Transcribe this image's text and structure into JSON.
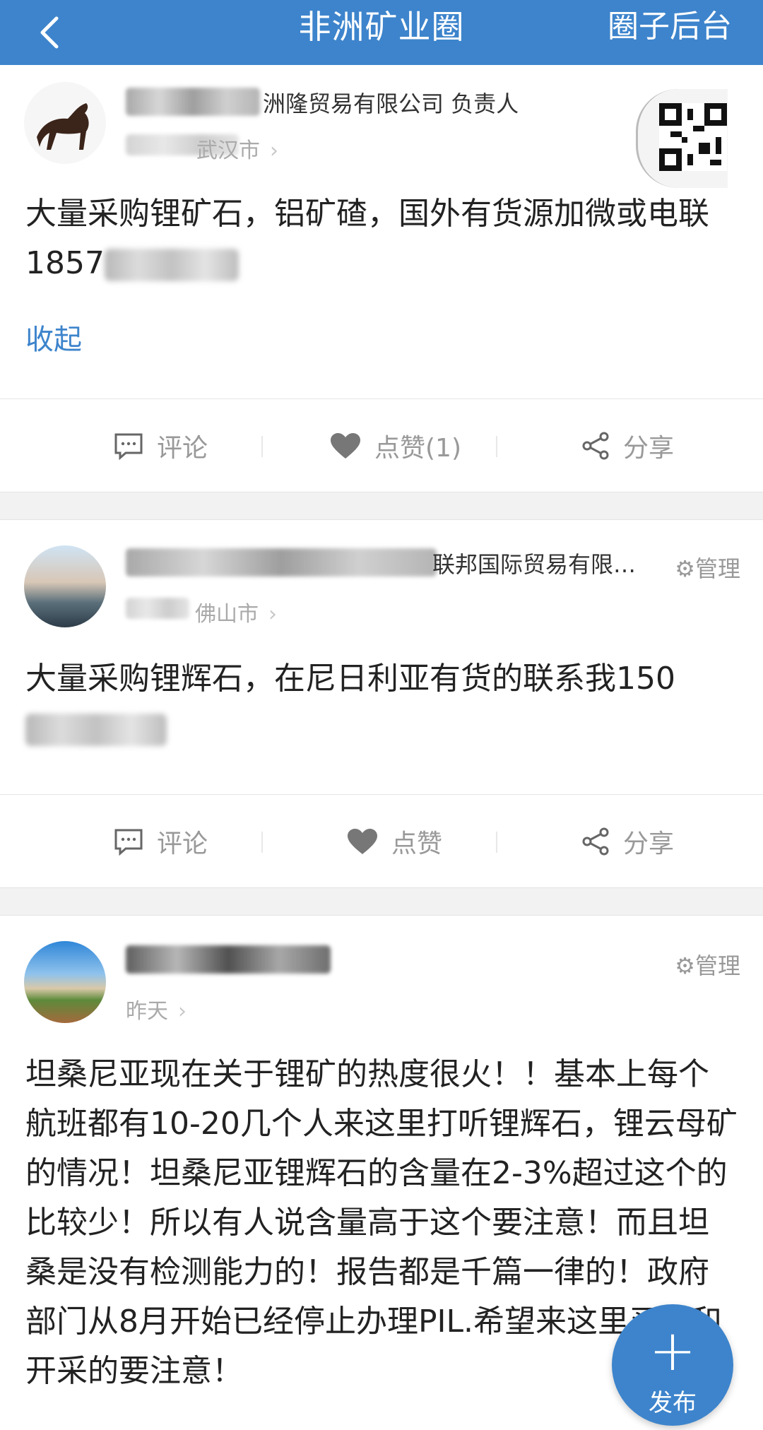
{
  "header": {
    "title": "非洲矿业圈",
    "admin_label": "圈子后台"
  },
  "posts": [
    {
      "company": "洲隆贸易有限公司 负责人",
      "location": "武汉市",
      "content": "大量采购锂矿石，铝矿碴，国外有货源加微或电联1857",
      "collapse_label": "收起",
      "actions": {
        "comment": "评论",
        "like": "点赞(1)",
        "share": "分享"
      }
    },
    {
      "company": "联邦国际贸易有限…",
      "location": "佛山市",
      "manage": "管理",
      "content": "大量采购锂辉石，在尼日利亚有货的联系我150",
      "actions": {
        "comment": "评论",
        "like": "点赞",
        "share": "分享"
      }
    },
    {
      "time": "昨天",
      "manage": "管理",
      "content": "坦桑尼亚现在关于锂矿的热度很火！！基本上每个航班都有10-20几个人来这里打听锂辉石，锂云母矿的情况！坦桑尼亚锂辉石的含量在2-3%超过这个的比较少！所以有人说含量高于这个要注意！而且坦桑是没有检测能力的！报告都是千篇一律的！政府部门从8月开始已经停止办理PIL.希望来这里买矿和开采的要注意！"
    }
  ],
  "fab": {
    "icon": "plus-icon",
    "label": "发布"
  },
  "colors": {
    "brand": "#3d84cc",
    "background_gap": "#f2f2f2",
    "muted_text": "#999999"
  }
}
